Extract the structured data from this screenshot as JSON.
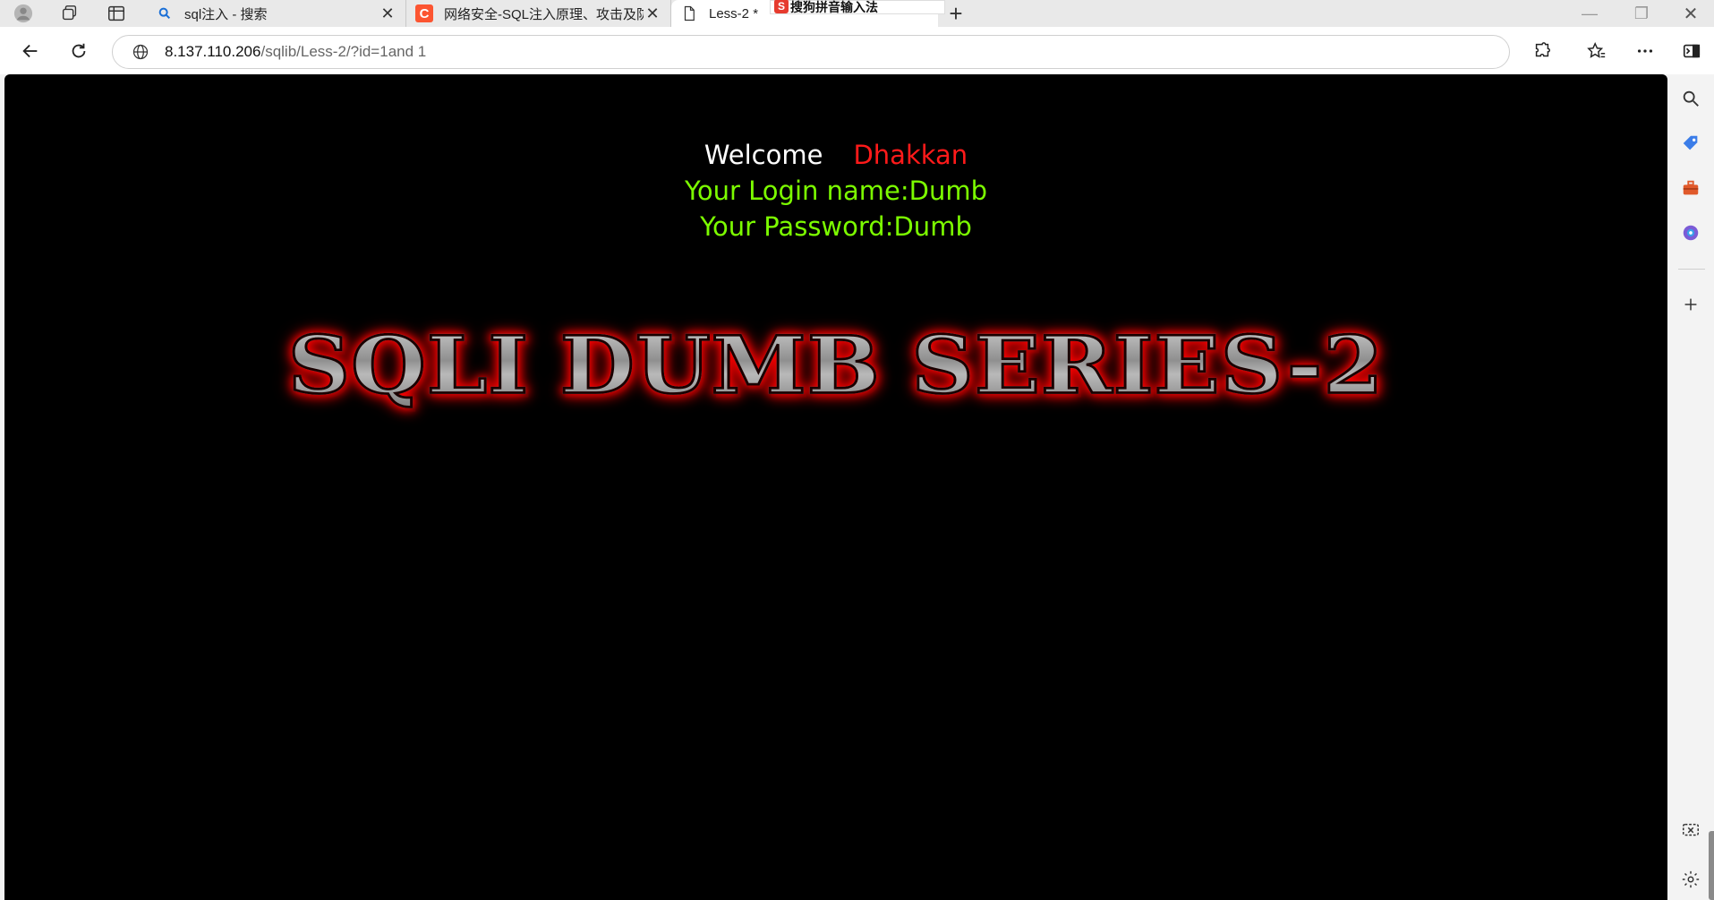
{
  "tabs": [
    {
      "title": "sql注入 - 搜索",
      "icon": "search-favicon-icon"
    },
    {
      "title": "网络安全-SQL注入原理、攻击及防",
      "icon": "csdn-favicon-icon"
    },
    {
      "title": "Less-2 *",
      "icon": "page-icon"
    }
  ],
  "ime": {
    "label": "搜狗拼音输入法"
  },
  "address": {
    "host": "8.137.110.206",
    "path": "/sqlib/Less-2/?id=1and 1"
  },
  "page": {
    "welcome": "Welcome",
    "name": "Dhakkan",
    "login": "Your Login name:Dumb",
    "password": "Your Password:Dumb",
    "banner": "SQLI DUMB SERIES-2"
  },
  "colors": {
    "welcome": "#ffffff",
    "name": "#ff1a1a",
    "info": "#7cfc00",
    "page_bg": "#000000",
    "banner_glow": "#ff0000"
  },
  "sidebar_icons": [
    "search-icon",
    "tag-icon",
    "toolbox-icon",
    "office-icon",
    "add-icon",
    "screenshot-icon",
    "settings-icon"
  ]
}
